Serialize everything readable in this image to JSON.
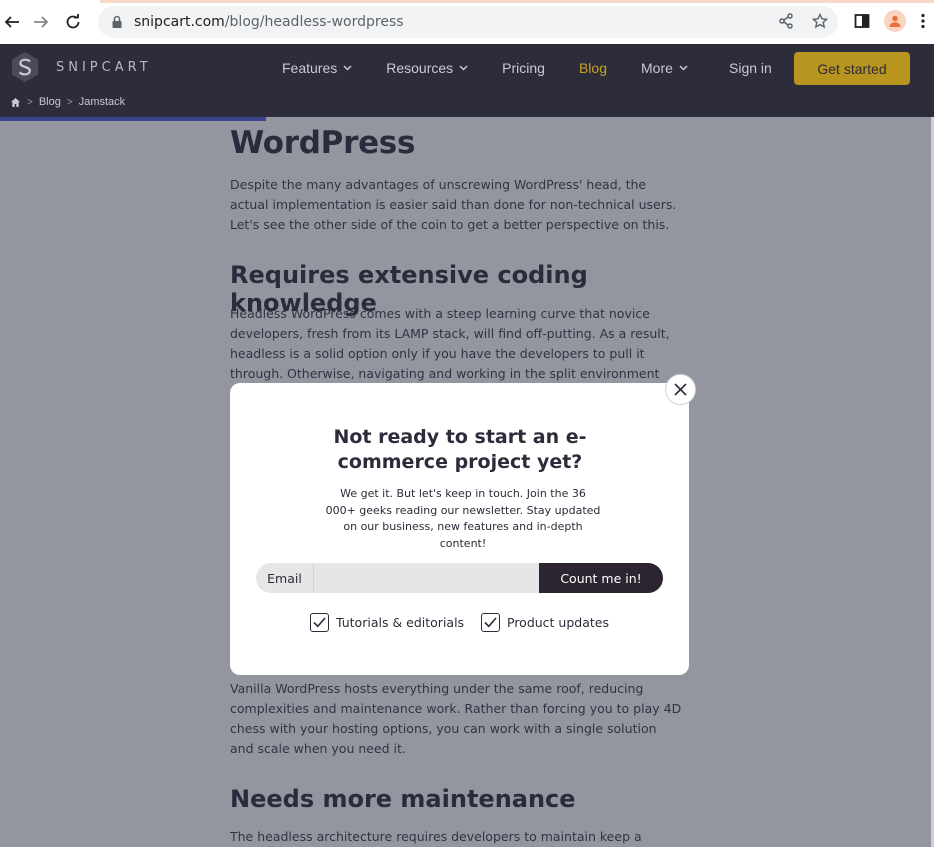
{
  "browser": {
    "url_domain": "snipcart.com",
    "url_path": "/blog/headless-wordpress"
  },
  "header": {
    "logo_text": "SNIPCART",
    "menu": [
      {
        "label": "Features",
        "has_dropdown": true
      },
      {
        "label": "Resources",
        "has_dropdown": true
      },
      {
        "label": "Pricing",
        "has_dropdown": false
      },
      {
        "label": "Blog",
        "has_dropdown": false,
        "active": true
      },
      {
        "label": "More",
        "has_dropdown": true
      }
    ],
    "sign_in": "Sign in",
    "get_started": "Get started",
    "breadcrumb": [
      "Blog",
      "Jamstack"
    ],
    "accent_color": "#c9a11f"
  },
  "article": {
    "heading": "WordPress",
    "intro": "Despite the many advantages of unscrewing WordPress' head, the actual implementation is easier said than done for non-technical users. Let's see the other side of the coin to get a better perspective on this.",
    "section1_title": "Requires extensive coding knowledge",
    "section1_text": "Headless WordPress comes with a steep learning curve that novice developers, fresh from its LAMP stack, will find off-putting. As a result, headless is a solid option only if you have the developers to pull it through. Otherwise, navigating and working in the split environment takes some",
    "section2_text": "Vanilla WordPress hosts everything under the same roof, reducing complexities and maintenance work. Rather than forcing you to play 4D chess with your hosting options, you can work with a single solution and scale when you need it.",
    "section3_title": "Needs more maintenance",
    "section3_text": "The headless architecture requires developers to maintain keep a larger"
  },
  "modal": {
    "title": "Not ready to start an e-commerce project yet?",
    "text": "We get it. But let's keep in touch. Join the 36 000+ geeks reading our newsletter. Stay updated on our business, new features and in-depth content!",
    "email_label": "Email",
    "email_value": "",
    "submit_label": "Count me in!",
    "checkboxes": [
      {
        "label": "Tutorials & editorials",
        "checked": true
      },
      {
        "label": "Product updates",
        "checked": true
      }
    ]
  }
}
